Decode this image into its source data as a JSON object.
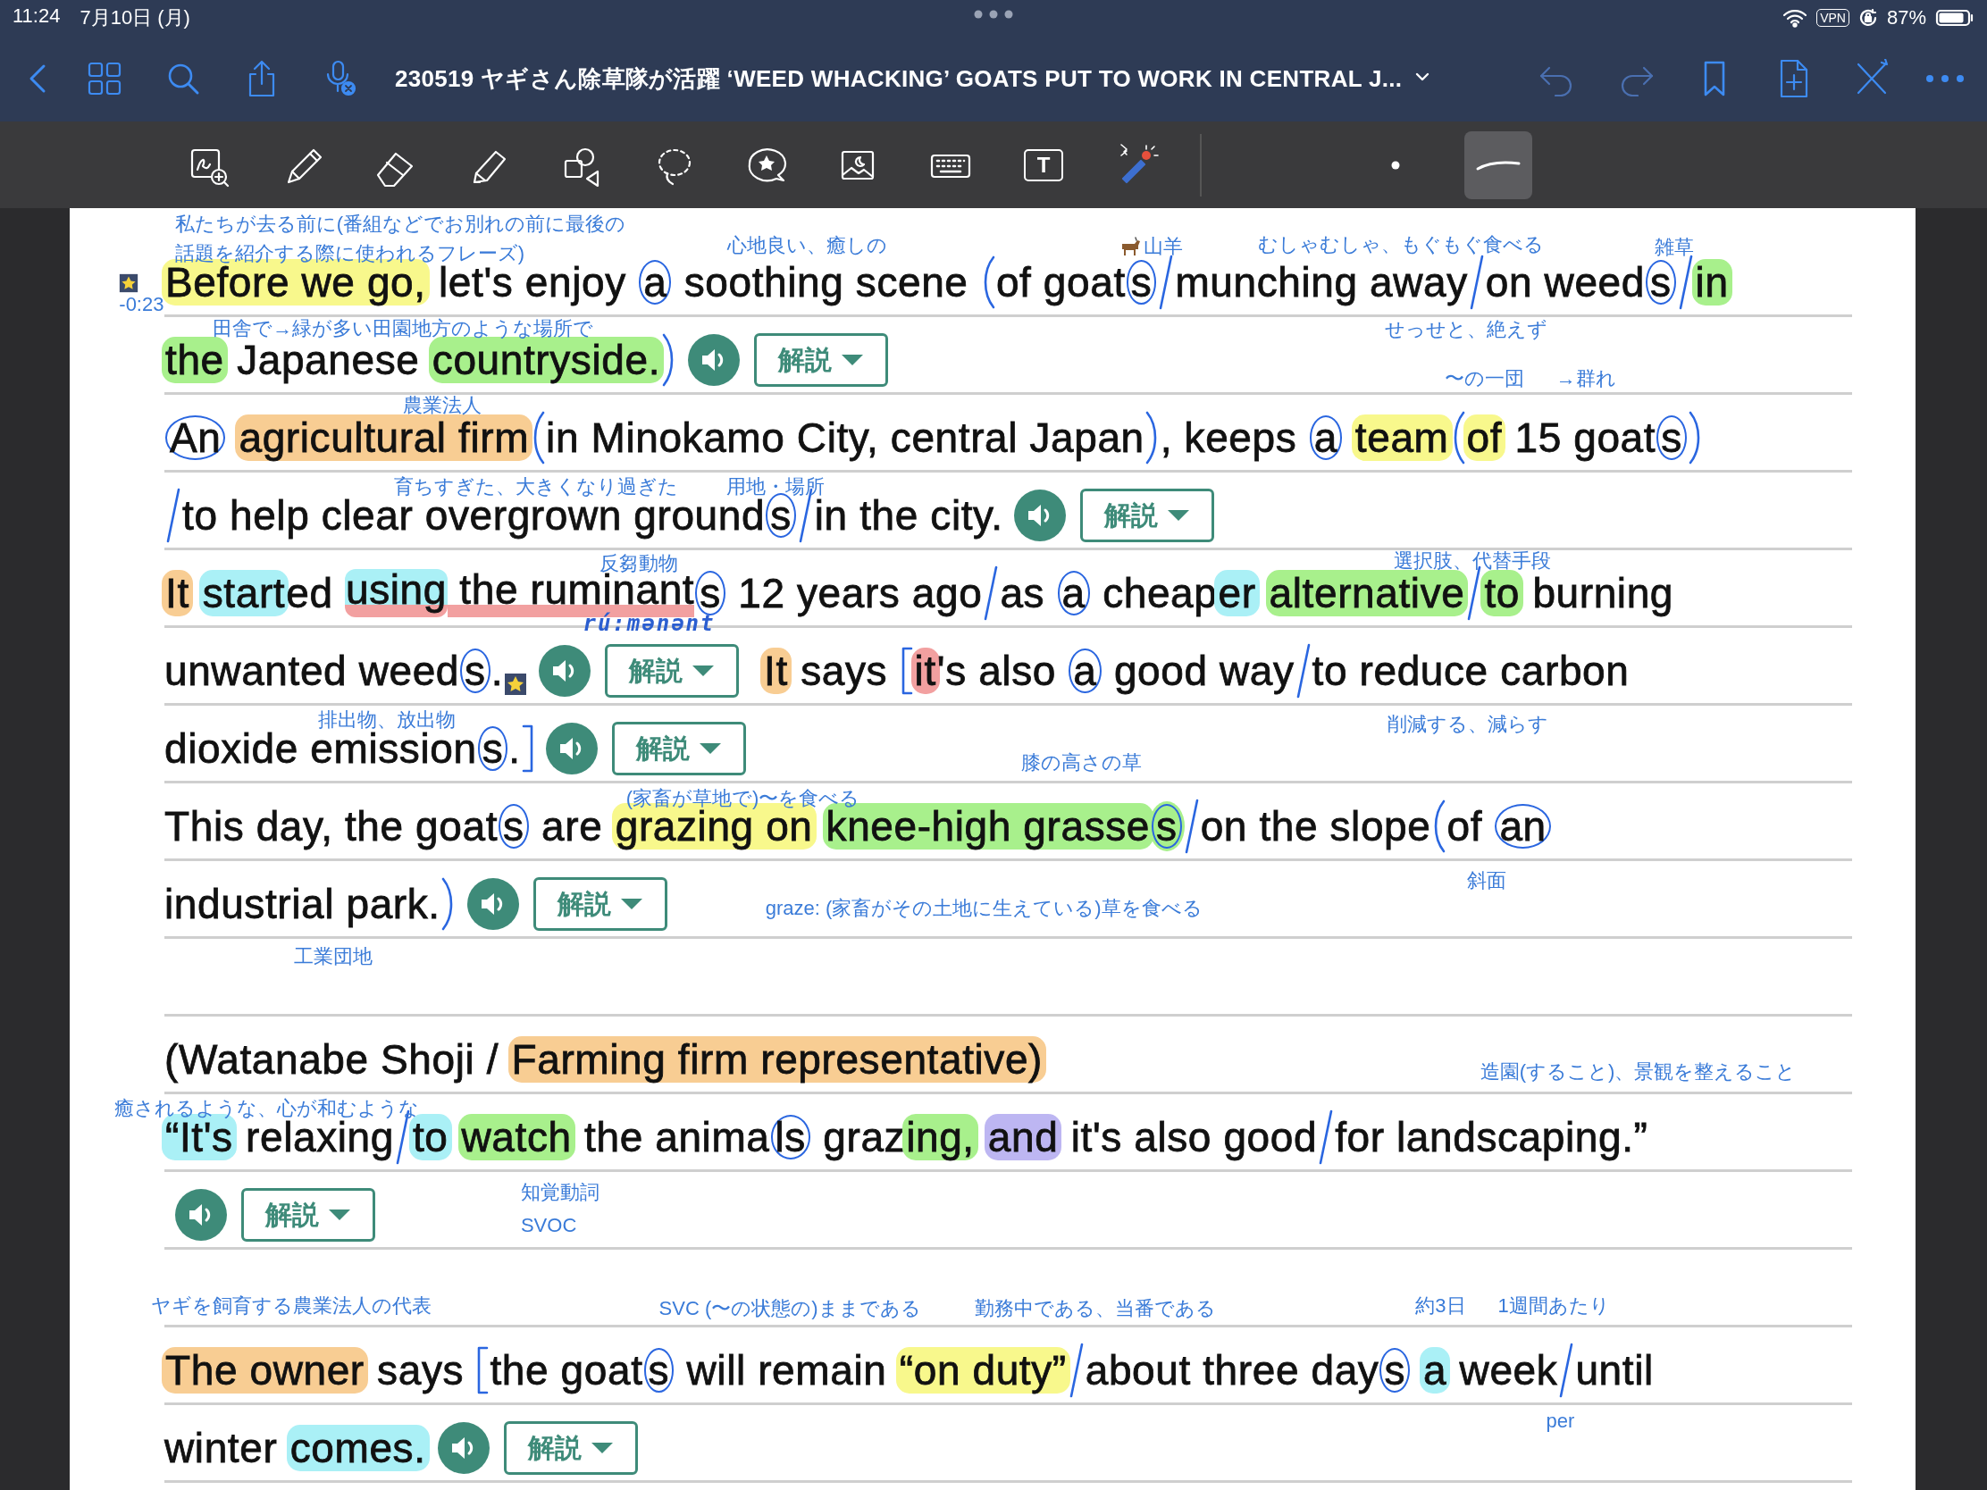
{
  "status_bar": {
    "time": "11:24",
    "date": "7月10日 (月)",
    "vpn": "VPN",
    "battery": "87%"
  },
  "nav_bar": {
    "title": "230519 ヤギさん除草隊が活躍 ‘WEED WHACKING’ GOATS PUT TO WORK IN CENTRAL J..."
  },
  "tools": [
    {
      "kind": "zoom",
      "selected": false
    },
    {
      "kind": "pen",
      "selected": false
    },
    {
      "kind": "eraser",
      "selected": false
    },
    {
      "kind": "highlighter",
      "selected": false
    },
    {
      "kind": "shapes",
      "selected": false
    },
    {
      "kind": "lasso",
      "selected": false
    },
    {
      "kind": "sticker",
      "selected": false
    },
    {
      "kind": "image",
      "selected": false
    },
    {
      "kind": "keyboard",
      "selected": false
    },
    {
      "kind": "textbox",
      "label": "T",
      "selected": false
    },
    {
      "kind": "laser",
      "selected": false
    },
    {
      "kind": "size",
      "selected": false
    },
    {
      "kind": "stroke",
      "selected": true
    }
  ],
  "lines": [
    {
      "kind": "text",
      "segments": [
        {
          "kind": "text",
          "text": "Before we go,",
          "color": "#f8f88c"
        },
        {
          "kind": "text",
          "text": " let's enjoy "
        },
        {
          "kind": "text",
          "text": "a",
          "circled": true
        },
        {
          "kind": "text",
          "text": " soothing scene "
        },
        {
          "kind": "paren_open"
        },
        {
          "kind": "text",
          "text": "of goat"
        },
        {
          "kind": "text",
          "text": "s",
          "circled": true
        },
        {
          "kind": "slash"
        },
        {
          "kind": "text",
          "text": "munching away"
        },
        {
          "kind": "slash"
        },
        {
          "kind": "text",
          "text": "on weed"
        },
        {
          "kind": "text",
          "text": "s",
          "circled": true
        },
        {
          "kind": "slash"
        },
        {
          "kind": "text",
          "text": "in",
          "color": "#a8f08c"
        }
      ]
    },
    {
      "kind": "text",
      "segments": [
        {
          "kind": "text",
          "text": "the",
          "color": "#a8f08c"
        },
        {
          "kind": "text",
          "text": " Japanese "
        },
        {
          "kind": "text",
          "text": "countryside.",
          "color": "#a8f08c"
        },
        {
          "kind": "paren_close"
        },
        {
          "kind": "speaker"
        },
        {
          "kind": "explain",
          "label": "解説"
        }
      ]
    },
    {
      "kind": "text",
      "segments": [
        {
          "kind": "text",
          "text": "An",
          "circled": true
        },
        {
          "kind": "space"
        },
        {
          "kind": "text",
          "text": "agricultural firm",
          "color": "#f8cd93"
        },
        {
          "kind": "paren_open"
        },
        {
          "kind": "text",
          "text": "in Minokamo City, central Japan"
        },
        {
          "kind": "paren_close"
        },
        {
          "kind": "text",
          "text": ", keeps "
        },
        {
          "kind": "text",
          "text": "a",
          "circled": true
        },
        {
          "kind": "space"
        },
        {
          "kind": "text",
          "text": "team",
          "color": "#f8f88c"
        },
        {
          "kind": "paren_open"
        },
        {
          "kind": "text",
          "text": "of",
          "color": "#f8f88c"
        },
        {
          "kind": "text",
          "text": " 15 goat"
        },
        {
          "kind": "text",
          "text": "s",
          "circled": true
        },
        {
          "kind": "paren_close"
        }
      ]
    },
    {
      "kind": "text",
      "segments": [
        {
          "kind": "slash"
        },
        {
          "kind": "text",
          "text": "to help clear overgrown ground"
        },
        {
          "kind": "text",
          "text": "s",
          "circled": true
        },
        {
          "kind": "slash"
        },
        {
          "kind": "text",
          "text": "in the city."
        },
        {
          "kind": "speaker"
        },
        {
          "kind": "explain",
          "label": "解説"
        }
      ]
    },
    {
      "kind": "text",
      "segments": [
        {
          "kind": "text",
          "text": "It",
          "color": "#f8cd93"
        },
        {
          "kind": "space"
        },
        {
          "kind": "text",
          "text": "start",
          "color": "#aaf0f6"
        },
        {
          "kind": "text",
          "text": "ed "
        },
        {
          "kind": "text",
          "text": "using",
          "color": "#aaf0f6",
          "underlined": true
        },
        {
          "kind": "text",
          "text": " the ruminant",
          "underlined": true
        },
        {
          "kind": "text",
          "text": "s",
          "circled": true
        },
        {
          "kind": "text",
          "text": " 12 years ago"
        },
        {
          "kind": "slash"
        },
        {
          "kind": "text",
          "text": "as "
        },
        {
          "kind": "text",
          "text": "a",
          "circled": true
        },
        {
          "kind": "text",
          "text": " cheap"
        },
        {
          "kind": "text",
          "text": "er",
          "color": "#aaf0f6"
        },
        {
          "kind": "space"
        },
        {
          "kind": "text",
          "text": "alternative",
          "color": "#a8f08c"
        },
        {
          "kind": "slash"
        },
        {
          "kind": "text",
          "text": "to",
          "color": "#a8f08c"
        },
        {
          "kind": "text",
          "text": " burning"
        }
      ]
    },
    {
      "kind": "text",
      "segments": [
        {
          "kind": "text",
          "text": "unwanted weed"
        },
        {
          "kind": "text",
          "text": "s",
          "circled": true
        },
        {
          "kind": "text",
          "text": "."
        },
        {
          "kind": "star"
        },
        {
          "kind": "speaker"
        },
        {
          "kind": "explain",
          "label": "解説"
        },
        {
          "kind": "space"
        },
        {
          "kind": "text",
          "text": "It",
          "color": "#f8cd93"
        },
        {
          "kind": "text",
          "text": " says "
        },
        {
          "kind": "bracket_open"
        },
        {
          "kind": "text",
          "text": "it",
          "color": "#f2a0a0"
        },
        {
          "kind": "text",
          "text": "'s also "
        },
        {
          "kind": "text",
          "text": "a",
          "circled": true
        },
        {
          "kind": "text",
          "text": " good way"
        },
        {
          "kind": "slash"
        },
        {
          "kind": "text",
          "text": "to reduce carbon"
        }
      ]
    },
    {
      "kind": "text",
      "segments": [
        {
          "kind": "text",
          "text": "dioxide emission"
        },
        {
          "kind": "text",
          "text": "s",
          "circled": true
        },
        {
          "kind": "text",
          "text": "."
        },
        {
          "kind": "bracket_close"
        },
        {
          "kind": "speaker"
        },
        {
          "kind": "explain",
          "label": "解説"
        }
      ]
    },
    {
      "kind": "text",
      "segments": [
        {
          "kind": "text",
          "text": "This day, the goat"
        },
        {
          "kind": "text",
          "text": "s",
          "circled": true
        },
        {
          "kind": "text",
          "text": " are "
        },
        {
          "kind": "text",
          "text": "grazing on",
          "color": "#f8f88c"
        },
        {
          "kind": "space"
        },
        {
          "kind": "text",
          "text": "knee-high grasse",
          "color": "#a8f08c"
        },
        {
          "kind": "text",
          "text": "s",
          "circled": true,
          "color": "#a8f08c"
        },
        {
          "kind": "slash"
        },
        {
          "kind": "text",
          "text": "on the slope"
        },
        {
          "kind": "paren_open"
        },
        {
          "kind": "text",
          "text": "of "
        },
        {
          "kind": "text",
          "text": "an",
          "circled": true
        }
      ]
    },
    {
      "kind": "text",
      "segments": [
        {
          "kind": "text",
          "text": "industrial park."
        },
        {
          "kind": "paren_close"
        },
        {
          "kind": "speaker"
        },
        {
          "kind": "explain",
          "label": "解説"
        }
      ]
    },
    {
      "kind": "blank"
    },
    {
      "kind": "text",
      "segments": [
        {
          "kind": "text",
          "text": "(Watanabe Shoji / "
        },
        {
          "kind": "text",
          "text": "Farming firm representative)",
          "color": "#f8cd93"
        }
      ]
    },
    {
      "kind": "text",
      "segments": [
        {
          "kind": "text",
          "text": "“It's",
          "color": "#aaf0f6"
        },
        {
          "kind": "text",
          "text": " relaxing"
        },
        {
          "kind": "slash"
        },
        {
          "kind": "text",
          "text": "to",
          "color": "#aaf0f6"
        },
        {
          "kind": "space"
        },
        {
          "kind": "text",
          "text": "watch",
          "color": "#a8f08c"
        },
        {
          "kind": "text",
          "text": " the anima"
        },
        {
          "kind": "text",
          "text": "ls",
          "circled": true
        },
        {
          "kind": "text",
          "text": " graz"
        },
        {
          "kind": "text",
          "text": "ing,",
          "color": "#a8f08c"
        },
        {
          "kind": "space"
        },
        {
          "kind": "text",
          "text": "and",
          "color": "#bdb6f2"
        },
        {
          "kind": "text",
          "text": " it's also good"
        },
        {
          "kind": "slash"
        },
        {
          "kind": "text",
          "text": "for landscaping.”"
        }
      ]
    },
    {
      "kind": "text",
      "segments": [
        {
          "kind": "speaker"
        },
        {
          "kind": "explain",
          "label": "解説"
        }
      ]
    },
    {
      "kind": "blank"
    },
    {
      "kind": "text",
      "segments": [
        {
          "kind": "text",
          "text": "The owner",
          "color": "#f8cd93"
        },
        {
          "kind": "text",
          "text": " says "
        },
        {
          "kind": "bracket_open"
        },
        {
          "kind": "text",
          "text": "the goat"
        },
        {
          "kind": "text",
          "text": "s",
          "circled": true
        },
        {
          "kind": "text",
          "text": " will remain "
        },
        {
          "kind": "text",
          "text": "“on duty”",
          "color": "#f8f88c"
        },
        {
          "kind": "slash"
        },
        {
          "kind": "text",
          "text": "about three day"
        },
        {
          "kind": "text",
          "text": "s",
          "circled": true
        },
        {
          "kind": "space"
        },
        {
          "kind": "text",
          "text": "a",
          "color": "#aaf0f6"
        },
        {
          "kind": "text",
          "text": " week"
        },
        {
          "kind": "slash"
        },
        {
          "kind": "text",
          "text": "until"
        }
      ]
    },
    {
      "kind": "text",
      "segments": [
        {
          "kind": "text",
          "text": "winter "
        },
        {
          "kind": "text",
          "text": "comes.",
          "color": "#aaf0f6"
        },
        {
          "kind": "speaker"
        },
        {
          "kind": "explain",
          "label": "解説"
        }
      ]
    }
  ],
  "notes": [
    {
      "kind": "typed",
      "text": "私たちが去る前に(番組などでお別れの前に最後の"
    },
    {
      "kind": "typed",
      "text": "話題を紹介する際に使われるフレーズ)"
    },
    {
      "kind": "timestamp",
      "text": "-0:23"
    },
    {
      "kind": "typed",
      "text": "心地良い、癒しの"
    },
    {
      "kind": "goat",
      "text": "山羊"
    },
    {
      "kind": "typed",
      "text": "むしゃむしゃ、もぐもぐ食べる"
    },
    {
      "kind": "typed",
      "text": "雑草"
    },
    {
      "kind": "typed",
      "text": "田舎で→緑が多い田園地方のような場所で"
    },
    {
      "kind": "typed",
      "text": "せっせと、絶えず"
    },
    {
      "kind": "typed",
      "text": "〜の一団"
    },
    {
      "kind": "typed",
      "text": "→群れ"
    },
    {
      "kind": "typed",
      "text": "農業法人"
    },
    {
      "kind": "typed",
      "text": "育ちすぎた、大きくなり過ぎた"
    },
    {
      "kind": "typed",
      "text": "用地・場所"
    },
    {
      "kind": "typed",
      "text": "反芻動物"
    },
    {
      "kind": "typed",
      "text": "選択肢、代替手段"
    },
    {
      "kind": "handwritten",
      "text": "rú:mənənt"
    },
    {
      "kind": "typed",
      "text": "排出物、放出物"
    },
    {
      "kind": "typed",
      "text": "削減する、減らす"
    },
    {
      "kind": "typed",
      "text": "膝の高さの草"
    },
    {
      "kind": "typed",
      "text": "(家畜が草地で)〜を食べる"
    },
    {
      "kind": "typed",
      "text": "斜面"
    },
    {
      "kind": "typed",
      "text": "graze: (家畜がその土地に生えている)草を食べる"
    },
    {
      "kind": "typed",
      "text": "工業団地"
    },
    {
      "kind": "typed",
      "text": "造園(すること)、景観を整えること"
    },
    {
      "kind": "typed",
      "text": "癒されるような、心が和むような"
    },
    {
      "kind": "typed",
      "text": "知覚動詞"
    },
    {
      "kind": "typed",
      "text": "SVOC"
    },
    {
      "kind": "typed",
      "text": "ヤギを飼育する農業法人の代表"
    },
    {
      "kind": "typed",
      "text": "SVC (〜の状態の)ままである"
    },
    {
      "kind": "typed",
      "text": "勤務中である、当番である"
    },
    {
      "kind": "typed",
      "text": "約3日"
    },
    {
      "kind": "typed",
      "text": "1週間あたり"
    },
    {
      "kind": "typed",
      "text": "per"
    }
  ]
}
